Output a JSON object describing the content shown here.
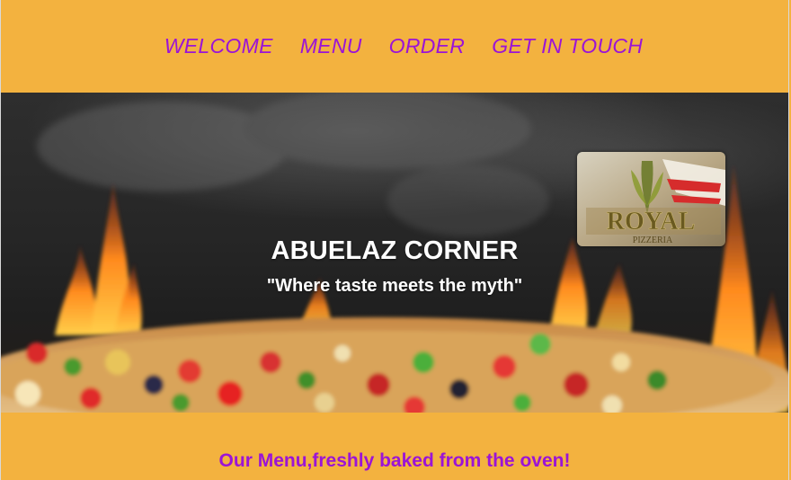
{
  "nav": {
    "items": [
      {
        "label": "WELCOME"
      },
      {
        "label": "MENU"
      },
      {
        "label": "ORDER"
      },
      {
        "label": "GET IN TOUCH"
      }
    ]
  },
  "hero": {
    "title": "ABUELAZ CORNER",
    "tagline": "\"Where taste meets the myth\"",
    "logo_text": "ROYAL",
    "logo_subtext": "PIZZERIA"
  },
  "menu_section": {
    "heading": "Our Menu,freshly baked from the oven!"
  },
  "colors": {
    "background": "#f3b23f",
    "nav_link": "#9b14d6",
    "hero_text": "#ffffff"
  }
}
